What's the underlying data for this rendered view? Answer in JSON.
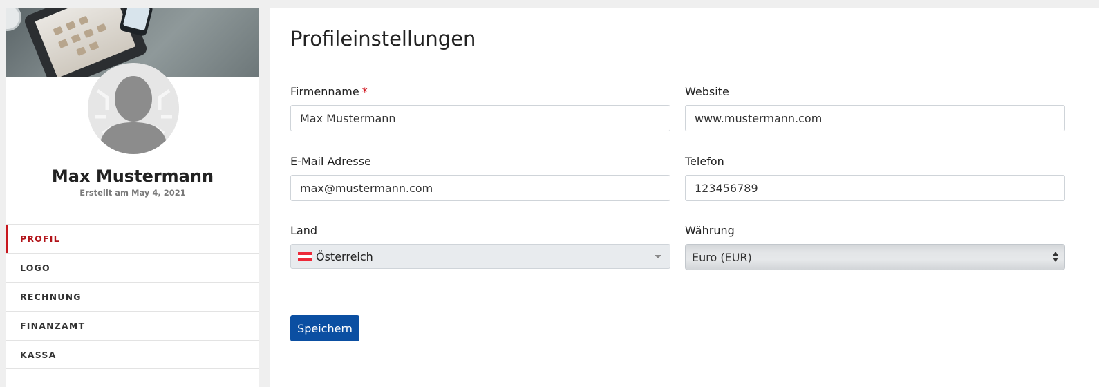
{
  "profile": {
    "name": "Max Mustermann",
    "created": "Erstellt am May 4, 2021"
  },
  "nav": {
    "items": [
      {
        "label": "PROFIL",
        "active": true
      },
      {
        "label": "LOGO"
      },
      {
        "label": "RECHNUNG"
      },
      {
        "label": "FINANZAMT"
      },
      {
        "label": "KASSA"
      }
    ]
  },
  "main": {
    "title": "Profileinstellungen",
    "fields": {
      "company": {
        "label": "Firmenname",
        "required_mark": "*",
        "value": "Max Mustermann"
      },
      "website": {
        "label": "Website",
        "value": "www.mustermann.com"
      },
      "email": {
        "label": "E-Mail Adresse",
        "value": "max@mustermann.com"
      },
      "phone": {
        "label": "Telefon",
        "value": "123456789"
      },
      "country": {
        "label": "Land",
        "value": "Österreich",
        "flag_colors": [
          "#ed2939",
          "#ffffff",
          "#ed2939"
        ]
      },
      "currency": {
        "label": "Währung",
        "value": "Euro (EUR)"
      }
    },
    "save_label": "Speichern"
  },
  "colors": {
    "accent": "#c8171e",
    "button": "#0b4fa2"
  }
}
